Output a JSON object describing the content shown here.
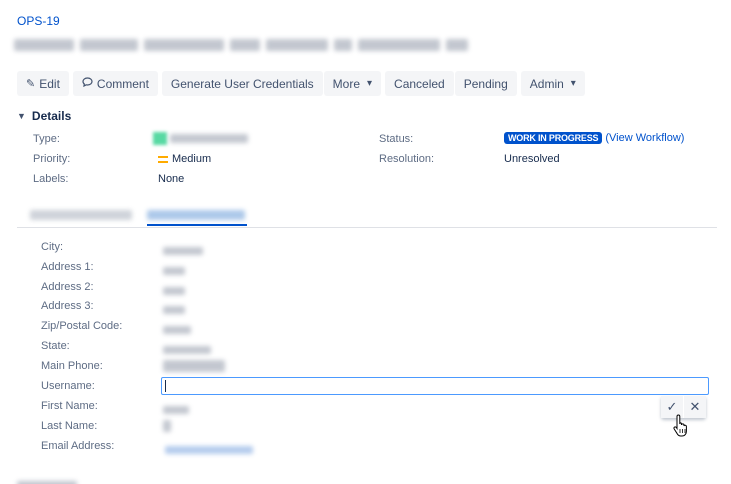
{
  "issue": {
    "key": "OPS-19"
  },
  "toolbar": {
    "edit_label": "Edit",
    "comment_label": "Comment",
    "generate_label": "Generate User Credentials",
    "more_label": "More",
    "canceled_label": "Canceled",
    "pending_label": "Pending",
    "admin_label": "Admin"
  },
  "details": {
    "heading": "Details",
    "type_label": "Type:",
    "priority_label": "Priority:",
    "priority_value": "Medium",
    "labels_label": "Labels:",
    "labels_value": "None",
    "status_label": "Status:",
    "status_value": "WORK IN PROGRESS",
    "view_workflow": "(View Workflow)",
    "resolution_label": "Resolution:",
    "resolution_value": "Unresolved"
  },
  "fields": {
    "city": "City:",
    "address1": "Address 1:",
    "address2": "Address 2:",
    "address3": "Address 3:",
    "zip": "Zip/Postal Code:",
    "state": "State:",
    "main_phone": "Main Phone:",
    "username": "Username:",
    "first_name": "First Name:",
    "last_name": "Last Name:",
    "email": "Email Address:"
  },
  "username_input": {
    "value": ""
  },
  "colors": {
    "accent": "#0052cc",
    "status_lozenge": "#0052cc",
    "priority_medium": "#ffab00",
    "focus_border": "#4c9aff"
  },
  "icons": {
    "edit": "pencil-icon",
    "comment": "comment-bubble-icon",
    "dropdown": "chevron-down-icon",
    "details_toggle": "chevron-down-icon",
    "confirm": "check-icon",
    "cancel": "close-icon",
    "pointer": "hand-pointer-cursor"
  }
}
